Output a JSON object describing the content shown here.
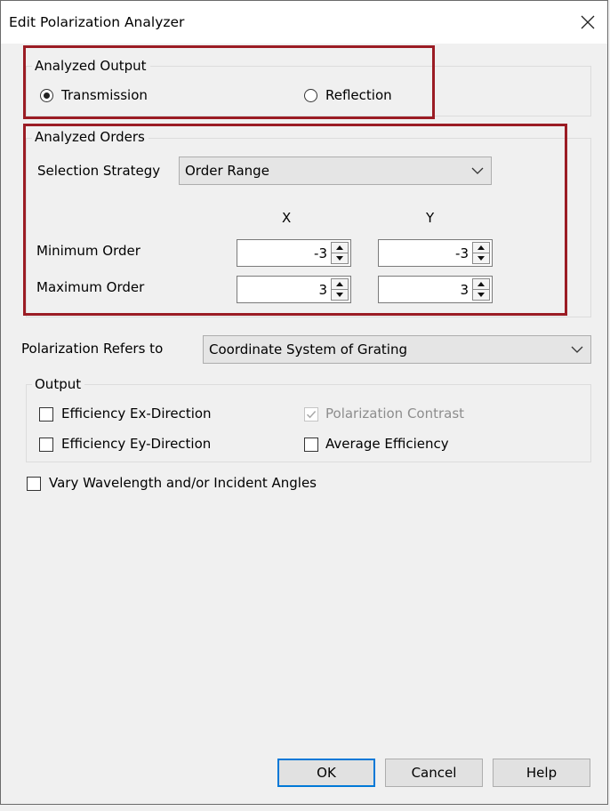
{
  "window": {
    "title": "Edit Polarization Analyzer"
  },
  "analyzed_output": {
    "legend": "Analyzed Output",
    "options": [
      {
        "label": "Transmission",
        "selected": true
      },
      {
        "label": "Reflection",
        "selected": false
      }
    ]
  },
  "analyzed_orders": {
    "legend": "Analyzed Orders",
    "strategy_label": "Selection Strategy",
    "strategy_value": "Order Range",
    "col_x": "X",
    "col_y": "Y",
    "min_label": "Minimum Order",
    "max_label": "Maximum Order",
    "min_x": "-3",
    "min_y": "-3",
    "max_x": "3",
    "max_y": "3"
  },
  "polarization": {
    "label": "Polarization Refers to",
    "value": "Coordinate System of Grating"
  },
  "output": {
    "legend": "Output",
    "items": [
      {
        "label": "Efficiency Ex-Direction",
        "checked": false,
        "enabled": true
      },
      {
        "label": "Polarization Contrast",
        "checked": true,
        "enabled": false
      },
      {
        "label": "Efficiency Ey-Direction",
        "checked": false,
        "enabled": true
      },
      {
        "label": "Average Efficiency",
        "checked": false,
        "enabled": true
      }
    ]
  },
  "vary": {
    "label": "Vary Wavelength and/or Incident Angles",
    "checked": false
  },
  "buttons": {
    "ok": "OK",
    "cancel": "Cancel",
    "help": "Help"
  },
  "colors": {
    "highlight_border": "#9b1c24",
    "default_button_border": "#0078d7"
  },
  "icons": {
    "close": "close-icon",
    "dropdown": "chevron-down-icon",
    "spin_up": "spin-up-icon",
    "spin_down": "spin-down-icon",
    "checkmark": "checkmark-icon"
  }
}
